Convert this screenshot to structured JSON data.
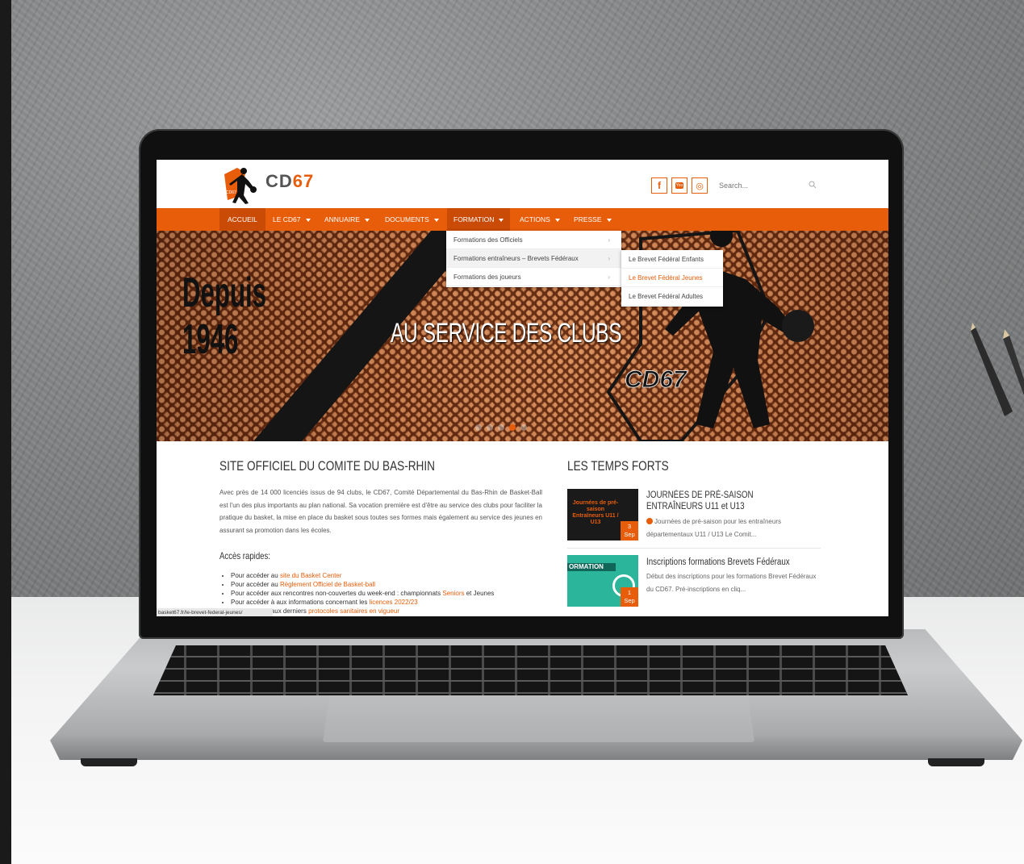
{
  "site": {
    "logo_text_a": "CD",
    "logo_text_b": "67",
    "logo_badge": "CD67",
    "brand_color": "#e85d0a",
    "social": [
      {
        "icon": "facebook-icon",
        "glyph": "f"
      },
      {
        "icon": "youtube-icon",
        "glyph": "You"
      },
      {
        "icon": "instagram-icon",
        "glyph": "◎"
      }
    ],
    "search_placeholder": "Search..."
  },
  "nav": {
    "items": [
      {
        "label": "ACCUEIL"
      },
      {
        "label": "LE CD67"
      },
      {
        "label": "ANNUAIRE"
      },
      {
        "label": "DOCUMENTS"
      },
      {
        "label": "FORMATION"
      },
      {
        "label": "ACTIONS"
      },
      {
        "label": "PRESSE"
      }
    ],
    "formation_menu": [
      {
        "label": "Formations des Officiels"
      },
      {
        "label": "Formations entraîneurs – Brevets Fédéraux"
      },
      {
        "label": "Formations des joueurs"
      }
    ],
    "brevets_submenu": [
      {
        "label": "Le Brevet Fédéral Enfants"
      },
      {
        "label": "Le Brevet Fédéral Jeunes"
      },
      {
        "label": "Le Brevet Fédéral Adultes"
      }
    ]
  },
  "hero": {
    "title": "AU SERVICE DES CLUBS",
    "since_line1": "Depuis",
    "since_line2": "1946",
    "watermark": "CD67"
  },
  "main": {
    "heading": "SITE OFFICIEL DU COMITE DU BAS-RHIN",
    "intro": "Avec près de 14 000 licenciés issus de 94 clubs, le CD67, Comité Départemental du Bas-Rhin de Basket-Ball est l'un des plus importants au plan national. Sa vocation première est d'être au service des clubs pour faciliter la pratique du basket, la mise en place du basket sous toutes ses formes mais également au service des jeunes en assurant sa promotion dans les écoles.",
    "quick_heading": "Accès rapides:",
    "quick": [
      {
        "pre": "Pour accéder au ",
        "link": "site du Basket Center",
        "post": ""
      },
      {
        "pre": "Pour accéder au ",
        "link": "Règlement Officiel de Basket-ball",
        "post": ""
      },
      {
        "pre": "Pour accéder aux rencontres non-couvertes du week-end : championnats ",
        "link": "Seniors",
        "post": " et Jeunes"
      },
      {
        "pre": "Pour accéder à aux informations concernant les ",
        "link": "licences 2022/23",
        "post": ""
      },
      {
        "pre": "Pour accéder aux derniers ",
        "link": "protocoles sanitaires en vigueur",
        "post": ""
      }
    ],
    "status_url": "basket67.fr/le-brevet-federal-jeunes/"
  },
  "news": {
    "heading": "LES TEMPS FORTS",
    "items": [
      {
        "title": "JOURNÉES DE PRÉ-SAISON ENTRAÎNEURS U11 et U13",
        "excerpt": "Journées de pré-saison pour les entraîneurs départementaux U11 / U13 Le Comit...",
        "thumb_text": "Journées de pré-saison Entraîneurs U11 / U13",
        "day": "3",
        "month": "Sep"
      },
      {
        "title": "Inscriptions formations Brevets Fédéraux",
        "excerpt": "Début des inscriptions pour les formations Brevet Fédéraux du CD67. Pré-inscriptions en cliq...",
        "thumb_text": "ORMATION",
        "day": "1",
        "month": "Sep"
      }
    ]
  }
}
